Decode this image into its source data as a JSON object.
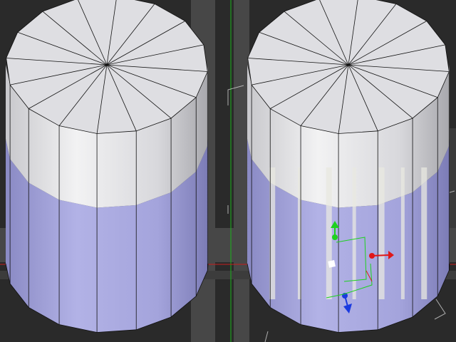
{
  "viewport": {
    "view": "perspective",
    "background_color": "#2a2a2a",
    "grid_band_color": "#4a4a4a",
    "axis_colors": {
      "x": "#c81e1e",
      "y": "#19b419",
      "z": "#2233dd"
    }
  },
  "objects": [
    {
      "name": "cylinder-left",
      "state": "unselected",
      "segments": 16,
      "top_color": "#dedee2",
      "side_color_light": "#eeeeef",
      "lower_color": "#a7a7e0"
    },
    {
      "name": "cylinder-right",
      "state": "selected",
      "segments": 16,
      "top_color": "#dedee2",
      "side_color_light": "#eeeeef",
      "lower_color": "#a7a7e0",
      "highlight_stripes": true
    }
  ],
  "gizmo": {
    "type": "move-widget",
    "x_color": "#e01818",
    "y_color": "#1ed21e",
    "z_color": "#1a3ae0"
  }
}
